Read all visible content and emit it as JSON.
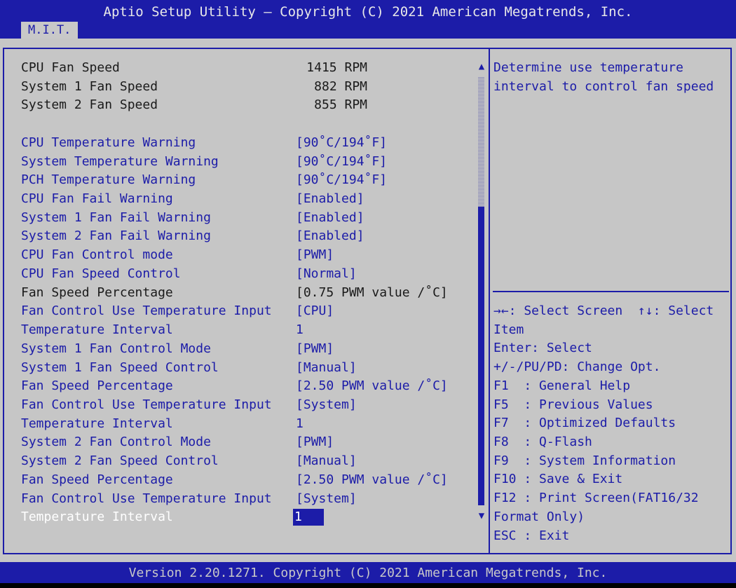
{
  "header": {
    "title": "Aptio Setup Utility – Copyright (C) 2021 American Megatrends, Inc.",
    "tab": "M.I.T."
  },
  "settings": [
    {
      "label": "CPU Fan Speed",
      "value": "1415 RPM",
      "kind": "readout"
    },
    {
      "label": "System 1 Fan Speed",
      "value": "882 RPM",
      "kind": "readout"
    },
    {
      "label": "System 2 Fan Speed",
      "value": "855 RPM",
      "kind": "readout"
    },
    {
      "label": "CPU Temperature Warning",
      "value": "[90˚C/194˚F]",
      "kind": "option"
    },
    {
      "label": "System Temperature Warning",
      "value": "[90˚C/194˚F]",
      "kind": "option"
    },
    {
      "label": "PCH Temperature Warning",
      "value": "[90˚C/194˚F]",
      "kind": "option"
    },
    {
      "label": "CPU Fan Fail Warning",
      "value": "[Enabled]",
      "kind": "option"
    },
    {
      "label": "System 1 Fan Fail Warning",
      "value": "[Enabled]",
      "kind": "option"
    },
    {
      "label": "System 2 Fan Fail Warning",
      "value": "[Enabled]",
      "kind": "option"
    },
    {
      "label": "CPU Fan Control mode",
      "value": "[PWM]",
      "kind": "option"
    },
    {
      "label": "CPU Fan Speed Control",
      "value": "[Normal]",
      "kind": "option"
    },
    {
      "label": "Fan Speed Percentage",
      "value": "[0.75 PWM value /˚C]",
      "kind": "readonly"
    },
    {
      "label": "Fan Control Use Temperature Input",
      "value": "[CPU]",
      "kind": "option"
    },
    {
      "label": "Temperature Interval",
      "value": "1",
      "kind": "option"
    },
    {
      "label": "System 1 Fan Control Mode",
      "value": "[PWM]",
      "kind": "option"
    },
    {
      "label": "System 1 Fan Speed Control",
      "value": "[Manual]",
      "kind": "option"
    },
    {
      "label": "Fan Speed Percentage",
      "value": "[2.50 PWM value /˚C]",
      "kind": "option"
    },
    {
      "label": "Fan Control Use Temperature Input",
      "value": "[System]",
      "kind": "option"
    },
    {
      "label": "Temperature Interval",
      "value": "1",
      "kind": "option"
    },
    {
      "label": "System 2 Fan Control Mode",
      "value": "[PWM]",
      "kind": "option"
    },
    {
      "label": "System 2 Fan Speed Control",
      "value": "[Manual]",
      "kind": "option"
    },
    {
      "label": "Fan Speed Percentage",
      "value": "[2.50 PWM value /˚C]",
      "kind": "option"
    },
    {
      "label": "Fan Control Use Temperature Input",
      "value": "[System]",
      "kind": "option"
    },
    {
      "label": "Temperature Interval",
      "value": "1",
      "kind": "selected"
    }
  ],
  "help": {
    "description": [
      "Determine use temperature",
      "interval to control fan speed"
    ],
    "keys": [
      "→←: Select Screen  ↑↓: Select",
      "Item",
      "Enter: Select",
      "+/-/PU/PD: Change Opt.",
      "F1  : General Help",
      "F5  : Previous Values",
      "F7  : Optimized Defaults",
      "F8  : Q-Flash",
      "F9  : System Information",
      "F10 : Save & Exit",
      "F12 : Print Screen(FAT16/32",
      "Format Only)",
      "ESC : Exit"
    ]
  },
  "scrollbar": {
    "up_icon": "▲",
    "down_icon": "▼"
  },
  "footer": "Version 2.20.1271. Copyright (C) 2021 American Megatrends, Inc.",
  "colors": {
    "accent": "#1c1ca8",
    "panel": "#c6c6c6",
    "text_dark": "#1a1a1a",
    "highlight_text": "#ffffff"
  }
}
